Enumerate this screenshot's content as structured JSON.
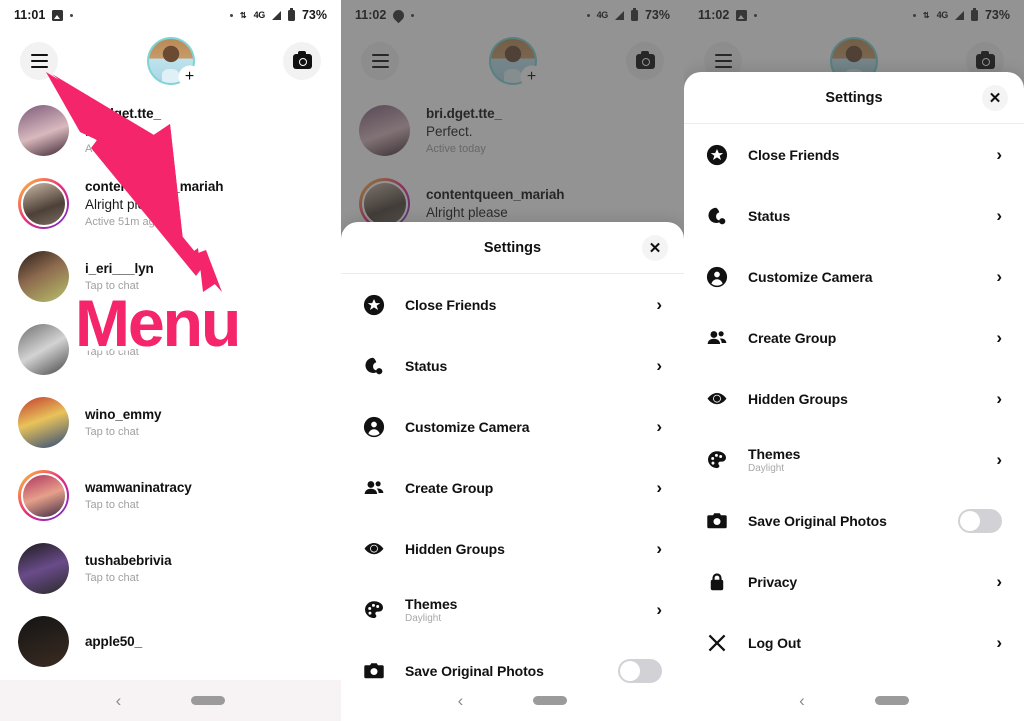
{
  "annotation": {
    "label": "Menu",
    "color": "#F4256B",
    "arrow": "arrow-pointing-to-hamburger-menu"
  },
  "panel_left": {
    "status": {
      "time": "11:01",
      "icons": [
        "image-icon",
        "dot-icon"
      ],
      "network": "4G",
      "battery": "73%"
    },
    "header": {
      "menu": "hamburger-menu-icon",
      "avatar": "profile-avatar",
      "add_badge": "+",
      "camera": "camera-icon"
    },
    "chats": [
      {
        "name": "bri.dget.tte_",
        "message": "Perfect.",
        "sub": "Active today",
        "ring": false
      },
      {
        "name": "contentqueen_mariah",
        "message": "Alright please",
        "sub": "Active 51m ago",
        "ring": true
      },
      {
        "name": "i_eri___lyn",
        "message": "",
        "sub": "Tap to chat",
        "ring": false
      },
      {
        "name": "",
        "message": "",
        "sub": "Tap to chat",
        "ring": false
      },
      {
        "name": "wino_emmy",
        "message": "",
        "sub": "Tap to chat",
        "ring": false
      },
      {
        "name": "wamwaninatracy",
        "message": "",
        "sub": "Tap to chat",
        "ring": true
      },
      {
        "name": "tushabebrivia",
        "message": "",
        "sub": "Tap to chat",
        "ring": false
      },
      {
        "name": "apple50_",
        "message": "",
        "sub": "",
        "ring": false
      }
    ],
    "nav": {
      "back": "‹",
      "pill": "home-pill"
    }
  },
  "panel_mid": {
    "status": {
      "time": "11:02",
      "icons": [
        "location-icon",
        "dot-icon"
      ],
      "network": "4G",
      "battery": "73%"
    },
    "header": {
      "menu": "hamburger-menu-icon",
      "avatar": "profile-avatar",
      "add_badge": "+",
      "camera": "camera-icon"
    },
    "chats": [
      {
        "name": "bri.dget.tte_",
        "message": "Perfect.",
        "sub": "Active today",
        "ring": false
      },
      {
        "name": "contentqueen_mariah",
        "message": "Alright please",
        "sub": "",
        "ring": true
      }
    ],
    "sheet": {
      "title": "Settings",
      "close": "✕",
      "items": [
        {
          "icon": "close-friends-star-icon",
          "label": "Close Friends",
          "sublabel": "",
          "control": "chevron"
        },
        {
          "icon": "status-icon",
          "label": "Status",
          "sublabel": "",
          "control": "chevron"
        },
        {
          "icon": "customize-camera-person-icon",
          "label": "Customize Camera",
          "sublabel": "",
          "control": "chevron"
        },
        {
          "icon": "create-group-people-icon",
          "label": "Create Group",
          "sublabel": "",
          "control": "chevron"
        },
        {
          "icon": "hidden-groups-eye-icon",
          "label": "Hidden Groups",
          "sublabel": "",
          "control": "chevron"
        },
        {
          "icon": "themes-palette-icon",
          "label": "Themes",
          "sublabel": "Daylight",
          "control": "chevron"
        },
        {
          "icon": "save-original-photos-camera-icon",
          "label": "Save Original Photos",
          "sublabel": "",
          "control": "toggle",
          "toggle_on": false
        }
      ]
    },
    "nav": {
      "back": "‹",
      "pill": "home-pill"
    }
  },
  "panel_right": {
    "status": {
      "time": "11:02",
      "icons": [
        "image-icon",
        "dot-icon"
      ],
      "network": "4G",
      "battery": "73%"
    },
    "header": {
      "menu": "hamburger-menu-icon",
      "avatar": "profile-avatar",
      "camera": "camera-icon"
    },
    "sheet": {
      "title": "Settings",
      "close": "✕",
      "items": [
        {
          "icon": "close-friends-star-icon",
          "label": "Close Friends",
          "sublabel": "",
          "control": "chevron"
        },
        {
          "icon": "status-icon",
          "label": "Status",
          "sublabel": "",
          "control": "chevron"
        },
        {
          "icon": "customize-camera-person-icon",
          "label": "Customize Camera",
          "sublabel": "",
          "control": "chevron"
        },
        {
          "icon": "create-group-people-icon",
          "label": "Create Group",
          "sublabel": "",
          "control": "chevron"
        },
        {
          "icon": "hidden-groups-eye-icon",
          "label": "Hidden Groups",
          "sublabel": "",
          "control": "chevron"
        },
        {
          "icon": "themes-palette-icon",
          "label": "Themes",
          "sublabel": "Daylight",
          "control": "chevron"
        },
        {
          "icon": "save-original-photos-camera-icon",
          "label": "Save Original Photos",
          "sublabel": "",
          "control": "toggle",
          "toggle_on": false
        },
        {
          "icon": "privacy-lock-icon",
          "label": "Privacy",
          "sublabel": "",
          "control": "chevron"
        },
        {
          "icon": "log-out-x-icon",
          "label": "Log Out",
          "sublabel": "",
          "control": "chevron"
        }
      ]
    },
    "nav": {
      "back": "‹",
      "pill": "home-pill"
    }
  }
}
